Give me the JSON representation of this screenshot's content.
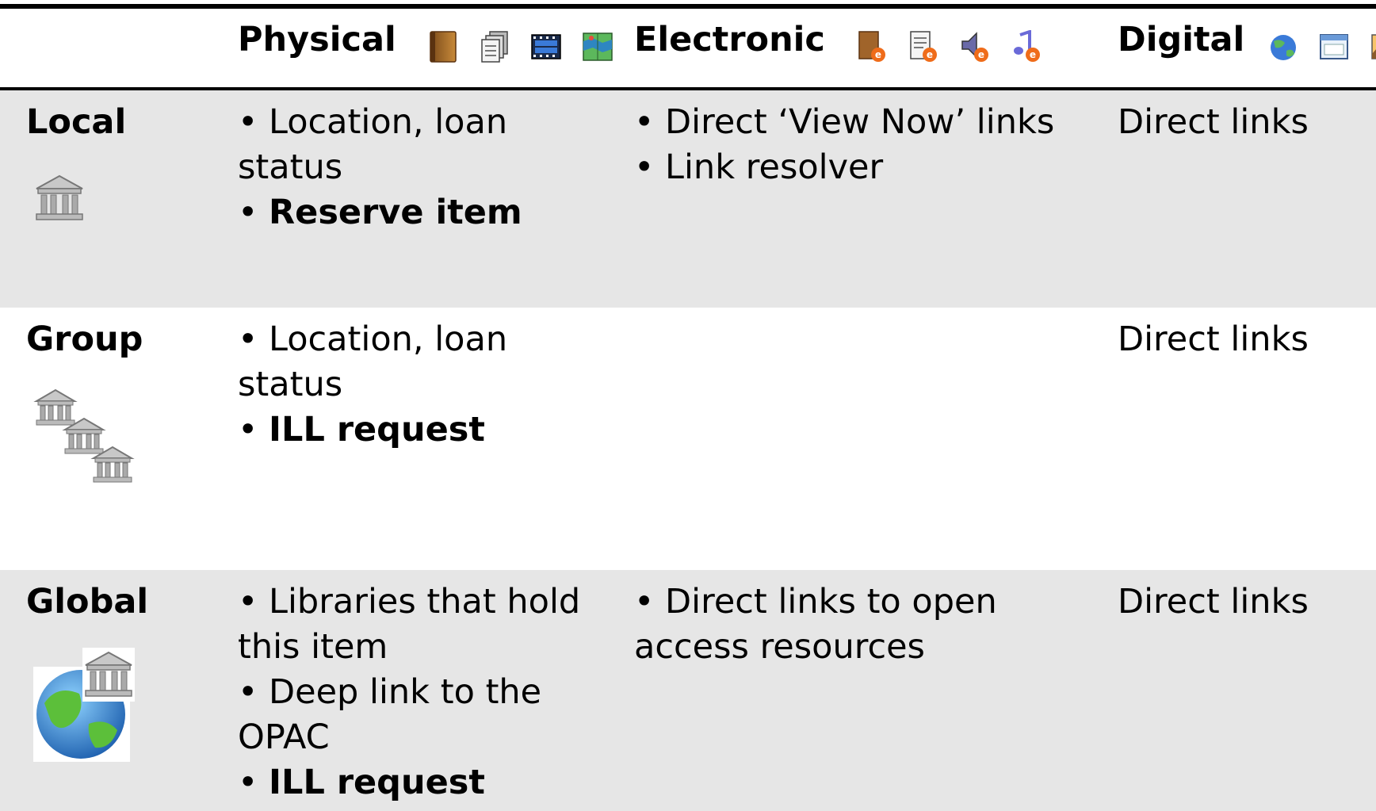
{
  "headers": {
    "physical": "Physical",
    "electronic": "Electronic",
    "digital": "Digital"
  },
  "header_icons": {
    "physical": [
      "book-icon",
      "stack-icon",
      "film-icon",
      "map-icon"
    ],
    "electronic": [
      "ebook-icon",
      "ejournal-icon",
      "eaudio-icon",
      "emusic-icon"
    ],
    "digital": [
      "globe-icon",
      "window-icon",
      "image-icon"
    ]
  },
  "rows": {
    "local": {
      "label": "Local",
      "icon": "library-icon",
      "physical": {
        "line1": "• Location, loan",
        "line2": "status",
        "line3_bullet": "• ",
        "line3_bold": "Reserve item"
      },
      "electronic": {
        "line1": "• Direct ‘View Now’ links",
        "line2": "• Link resolver"
      },
      "digital": "Direct links"
    },
    "group": {
      "label": "Group",
      "icon": "library-group-icon",
      "physical": {
        "line1": "• Location, loan",
        "line2": "status",
        "line3_bullet": "• ",
        "line3_bold": "ILL request"
      },
      "digital": "Direct links"
    },
    "global": {
      "label": "Global",
      "icon": "globe-library-icon",
      "physical": {
        "line1": "• Libraries that hold",
        "line2": "this item",
        "line3": "• Deep link to the",
        "line4": "OPAC",
        "line5_bullet": "• ",
        "line5_bold": "ILL request"
      },
      "electronic": {
        "line1": "• Direct links to open",
        "line2": "access resources"
      },
      "digital": "Direct links"
    }
  },
  "colors": {
    "row_shade": "#e6e6e6",
    "rule": "#000000"
  }
}
